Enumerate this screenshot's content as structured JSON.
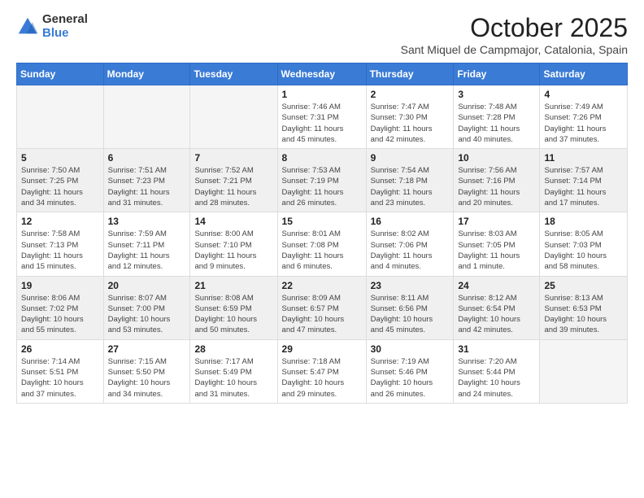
{
  "logo": {
    "general": "General",
    "blue": "Blue"
  },
  "title": "October 2025",
  "subtitle": "Sant Miquel de Campmajor, Catalonia, Spain",
  "days_of_week": [
    "Sunday",
    "Monday",
    "Tuesday",
    "Wednesday",
    "Thursday",
    "Friday",
    "Saturday"
  ],
  "weeks": [
    {
      "shaded": false,
      "days": [
        {
          "num": "",
          "info": ""
        },
        {
          "num": "",
          "info": ""
        },
        {
          "num": "",
          "info": ""
        },
        {
          "num": "1",
          "info": "Sunrise: 7:46 AM\nSunset: 7:31 PM\nDaylight: 11 hours\nand 45 minutes."
        },
        {
          "num": "2",
          "info": "Sunrise: 7:47 AM\nSunset: 7:30 PM\nDaylight: 11 hours\nand 42 minutes."
        },
        {
          "num": "3",
          "info": "Sunrise: 7:48 AM\nSunset: 7:28 PM\nDaylight: 11 hours\nand 40 minutes."
        },
        {
          "num": "4",
          "info": "Sunrise: 7:49 AM\nSunset: 7:26 PM\nDaylight: 11 hours\nand 37 minutes."
        }
      ]
    },
    {
      "shaded": true,
      "days": [
        {
          "num": "5",
          "info": "Sunrise: 7:50 AM\nSunset: 7:25 PM\nDaylight: 11 hours\nand 34 minutes."
        },
        {
          "num": "6",
          "info": "Sunrise: 7:51 AM\nSunset: 7:23 PM\nDaylight: 11 hours\nand 31 minutes."
        },
        {
          "num": "7",
          "info": "Sunrise: 7:52 AM\nSunset: 7:21 PM\nDaylight: 11 hours\nand 28 minutes."
        },
        {
          "num": "8",
          "info": "Sunrise: 7:53 AM\nSunset: 7:19 PM\nDaylight: 11 hours\nand 26 minutes."
        },
        {
          "num": "9",
          "info": "Sunrise: 7:54 AM\nSunset: 7:18 PM\nDaylight: 11 hours\nand 23 minutes."
        },
        {
          "num": "10",
          "info": "Sunrise: 7:56 AM\nSunset: 7:16 PM\nDaylight: 11 hours\nand 20 minutes."
        },
        {
          "num": "11",
          "info": "Sunrise: 7:57 AM\nSunset: 7:14 PM\nDaylight: 11 hours\nand 17 minutes."
        }
      ]
    },
    {
      "shaded": false,
      "days": [
        {
          "num": "12",
          "info": "Sunrise: 7:58 AM\nSunset: 7:13 PM\nDaylight: 11 hours\nand 15 minutes."
        },
        {
          "num": "13",
          "info": "Sunrise: 7:59 AM\nSunset: 7:11 PM\nDaylight: 11 hours\nand 12 minutes."
        },
        {
          "num": "14",
          "info": "Sunrise: 8:00 AM\nSunset: 7:10 PM\nDaylight: 11 hours\nand 9 minutes."
        },
        {
          "num": "15",
          "info": "Sunrise: 8:01 AM\nSunset: 7:08 PM\nDaylight: 11 hours\nand 6 minutes."
        },
        {
          "num": "16",
          "info": "Sunrise: 8:02 AM\nSunset: 7:06 PM\nDaylight: 11 hours\nand 4 minutes."
        },
        {
          "num": "17",
          "info": "Sunrise: 8:03 AM\nSunset: 7:05 PM\nDaylight: 11 hours\nand 1 minute."
        },
        {
          "num": "18",
          "info": "Sunrise: 8:05 AM\nSunset: 7:03 PM\nDaylight: 10 hours\nand 58 minutes."
        }
      ]
    },
    {
      "shaded": true,
      "days": [
        {
          "num": "19",
          "info": "Sunrise: 8:06 AM\nSunset: 7:02 PM\nDaylight: 10 hours\nand 55 minutes."
        },
        {
          "num": "20",
          "info": "Sunrise: 8:07 AM\nSunset: 7:00 PM\nDaylight: 10 hours\nand 53 minutes."
        },
        {
          "num": "21",
          "info": "Sunrise: 8:08 AM\nSunset: 6:59 PM\nDaylight: 10 hours\nand 50 minutes."
        },
        {
          "num": "22",
          "info": "Sunrise: 8:09 AM\nSunset: 6:57 PM\nDaylight: 10 hours\nand 47 minutes."
        },
        {
          "num": "23",
          "info": "Sunrise: 8:11 AM\nSunset: 6:56 PM\nDaylight: 10 hours\nand 45 minutes."
        },
        {
          "num": "24",
          "info": "Sunrise: 8:12 AM\nSunset: 6:54 PM\nDaylight: 10 hours\nand 42 minutes."
        },
        {
          "num": "25",
          "info": "Sunrise: 8:13 AM\nSunset: 6:53 PM\nDaylight: 10 hours\nand 39 minutes."
        }
      ]
    },
    {
      "shaded": false,
      "days": [
        {
          "num": "26",
          "info": "Sunrise: 7:14 AM\nSunset: 5:51 PM\nDaylight: 10 hours\nand 37 minutes."
        },
        {
          "num": "27",
          "info": "Sunrise: 7:15 AM\nSunset: 5:50 PM\nDaylight: 10 hours\nand 34 minutes."
        },
        {
          "num": "28",
          "info": "Sunrise: 7:17 AM\nSunset: 5:49 PM\nDaylight: 10 hours\nand 31 minutes."
        },
        {
          "num": "29",
          "info": "Sunrise: 7:18 AM\nSunset: 5:47 PM\nDaylight: 10 hours\nand 29 minutes."
        },
        {
          "num": "30",
          "info": "Sunrise: 7:19 AM\nSunset: 5:46 PM\nDaylight: 10 hours\nand 26 minutes."
        },
        {
          "num": "31",
          "info": "Sunrise: 7:20 AM\nSunset: 5:44 PM\nDaylight: 10 hours\nand 24 minutes."
        },
        {
          "num": "",
          "info": ""
        }
      ]
    }
  ]
}
